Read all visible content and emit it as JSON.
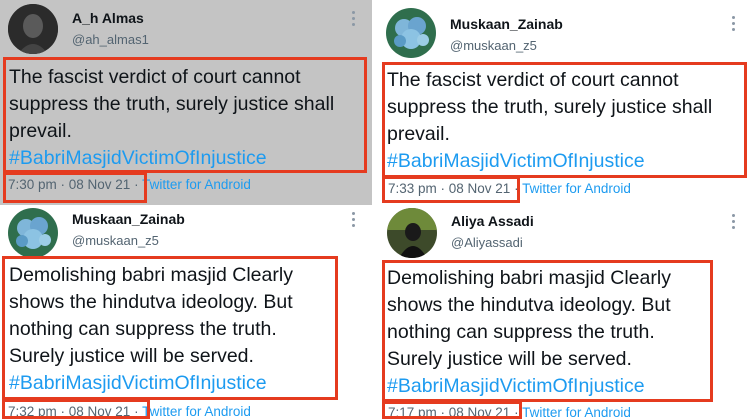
{
  "tweets": [
    {
      "name": "A_h Almas",
      "handle": "@ah_almas1",
      "lines": [
        "The fascist verdict of court cannot",
        "suppress the truth, surely justice shall",
        "prevail."
      ],
      "hashtag": "#BabriMasjidVictimOfInjustice",
      "time": "7:30 pm · 08 Nov 21",
      "sep": " · ",
      "source": "Twitter for Android"
    },
    {
      "name": "Muskaan_Zainab",
      "handle": "@muskaan_z5",
      "lines": [
        "The fascist verdict of court cannot",
        "suppress the truth, surely justice shall",
        "prevail."
      ],
      "hashtag": "#BabriMasjidVictimOfInjustice",
      "time": "7:33 pm · 08 Nov 21",
      "sep": " · ",
      "source": "Twitter for Android"
    },
    {
      "name": "Muskaan_Zainab",
      "handle": "@muskaan_z5",
      "lines": [
        "Demolishing babri masjid Clearly",
        "shows the hindutva ideology. But",
        "nothing can suppress the truth.",
        "Surely justice will be served."
      ],
      "hashtag": "#BabriMasjidVictimOfInjustice",
      "time": "7:32 pm · 08 Nov 21",
      "sep": " · ",
      "source": "Twitter for Android"
    },
    {
      "name": "Aliya Assadi",
      "handle": "@Aliyassadi",
      "lines": [
        "Demolishing babri masjid Clearly",
        "shows the hindutva ideology. But",
        "nothing can suppress the truth.",
        "Surely justice will be served."
      ],
      "hashtag": "#BabriMasjidVictimOfInjustice",
      "time": "7:17 pm · 08 Nov 21",
      "sep": " · ",
      "source": "Twitter for Android"
    }
  ],
  "colors": {
    "highlight": "#e53b1f",
    "link": "#1d9bf0",
    "text": "#0f1419",
    "muted": "#536471",
    "gray_panel": "#c4c4c4"
  }
}
